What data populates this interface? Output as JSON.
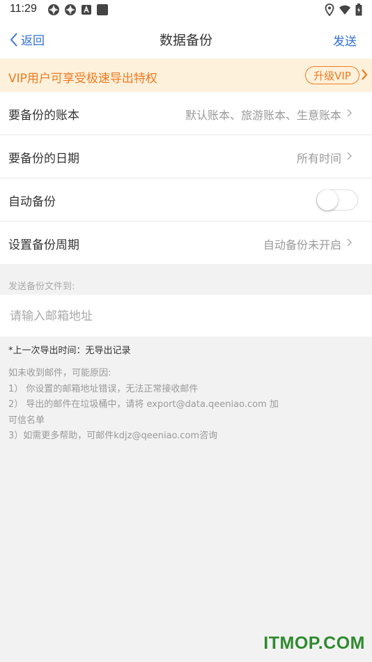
{
  "status_bar": {
    "time": "11:29",
    "left_icons": [
      "shutter-icon",
      "shutter-icon",
      "font-icon",
      "square-icon"
    ],
    "right_icons": [
      "location-icon",
      "wifi-icon",
      "battery-icon"
    ]
  },
  "nav": {
    "back_label": "返回",
    "title": "数据备份",
    "send_label": "发送",
    "accent_color": "#2f6fd6"
  },
  "vip": {
    "text": "VIP用户可享受极速导出特权",
    "button_label": "升级VIP",
    "color": "#ef7a1e",
    "background": "#fdf1dc"
  },
  "settings": {
    "books_label": "要备份的账本",
    "books_value": "默认账本、旅游账本、生意账本",
    "date_label": "要备份的日期",
    "date_value": "所有时间",
    "auto_label": "自动备份",
    "auto_enabled": false,
    "period_label": "设置备份周期",
    "period_value": "自动备份未开启"
  },
  "send_section": {
    "label": "发送备份文件到:",
    "email_placeholder": "请输入邮箱地址",
    "email_value": ""
  },
  "notes": {
    "last_export": "*上一次导出时间：无导出记录",
    "lines": [
      "如未收到邮件，可能原因:",
      "1） 你设置的邮箱地址错误，无法正常接收邮件",
      "2） 导出的邮件在垃圾桶中，请将 export@data.qeeniao.com 加",
      "可信名单",
      "3）如需更多帮助，可邮件kdjz@qeeniao.com咨询"
    ]
  },
  "watermark": "ITMOP.COM"
}
